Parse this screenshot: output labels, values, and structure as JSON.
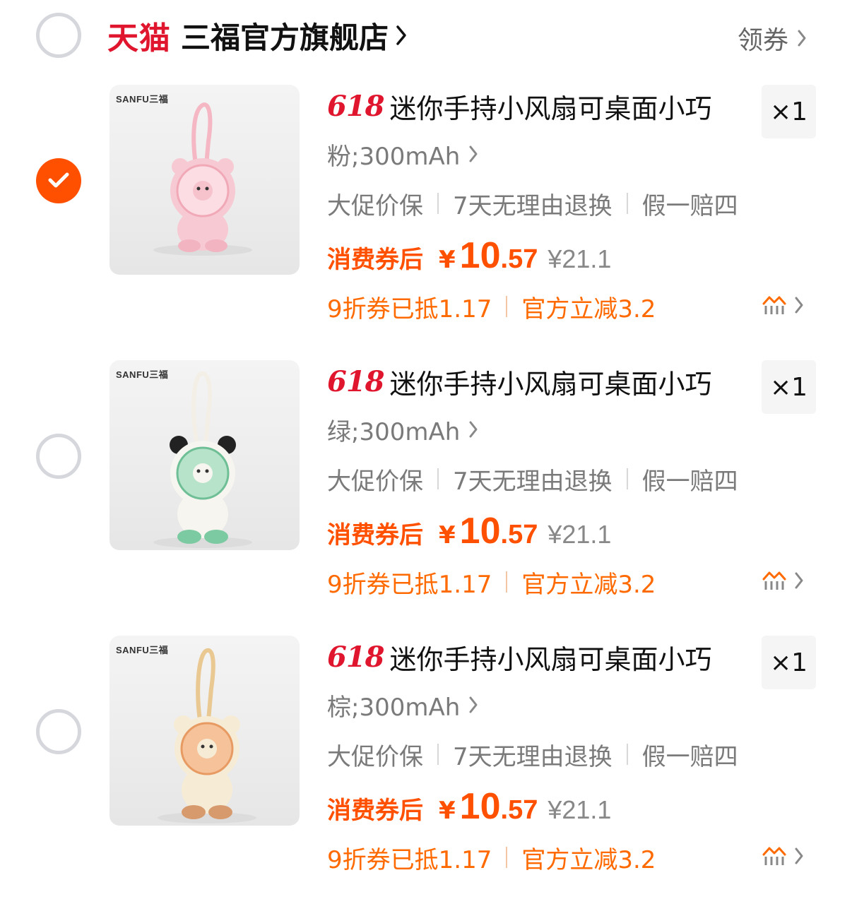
{
  "store": {
    "brand_logo_text": "天猫",
    "name": "三福官方旗舰店",
    "coupon_label": "领券",
    "selected": false
  },
  "items": [
    {
      "brand_mark": "SANFU三福",
      "promo_tag": "618",
      "title": "迷你手持小风扇可桌面小巧",
      "quantity": "×1",
      "sku": "粉;300mAh",
      "services": [
        "大促价保",
        "7天无理由退换",
        "假一赔四"
      ],
      "price_label": "消费券后",
      "currency": "¥",
      "price_integer": "10",
      "price_decimal": ".57",
      "original_price": "¥21.1",
      "discounts": [
        "9折券已抵1.17",
        "官方立减3.2"
      ],
      "selected": true,
      "color": "#f7c9d2"
    },
    {
      "brand_mark": "SANFU三福",
      "promo_tag": "618",
      "title": "迷你手持小风扇可桌面小巧",
      "quantity": "×1",
      "sku": "绿;300mAh",
      "services": [
        "大促价保",
        "7天无理由退换",
        "假一赔四"
      ],
      "price_label": "消费券后",
      "currency": "¥",
      "price_integer": "10",
      "price_decimal": ".57",
      "original_price": "¥21.1",
      "discounts": [
        "9折券已抵1.17",
        "官方立减3.2"
      ],
      "selected": false,
      "color": "#8fd3b0"
    },
    {
      "brand_mark": "SANFU三福",
      "promo_tag": "618",
      "title": "迷你手持小风扇可桌面小巧",
      "quantity": "×1",
      "sku": "棕;300mAh",
      "services": [
        "大促价保",
        "7天无理由退换",
        "假一赔四"
      ],
      "price_label": "消费券后",
      "currency": "¥",
      "price_integer": "10",
      "price_decimal": ".57",
      "original_price": "¥21.1",
      "discounts": [
        "9折券已抵1.17",
        "官方立减3.2"
      ],
      "selected": false,
      "color": "#f2b385"
    }
  ],
  "colors": {
    "accent": "#ff5000",
    "tmall_red": "#e0162e",
    "discount_orange": "#ff6a00",
    "muted_text": "#7a7a7a"
  }
}
